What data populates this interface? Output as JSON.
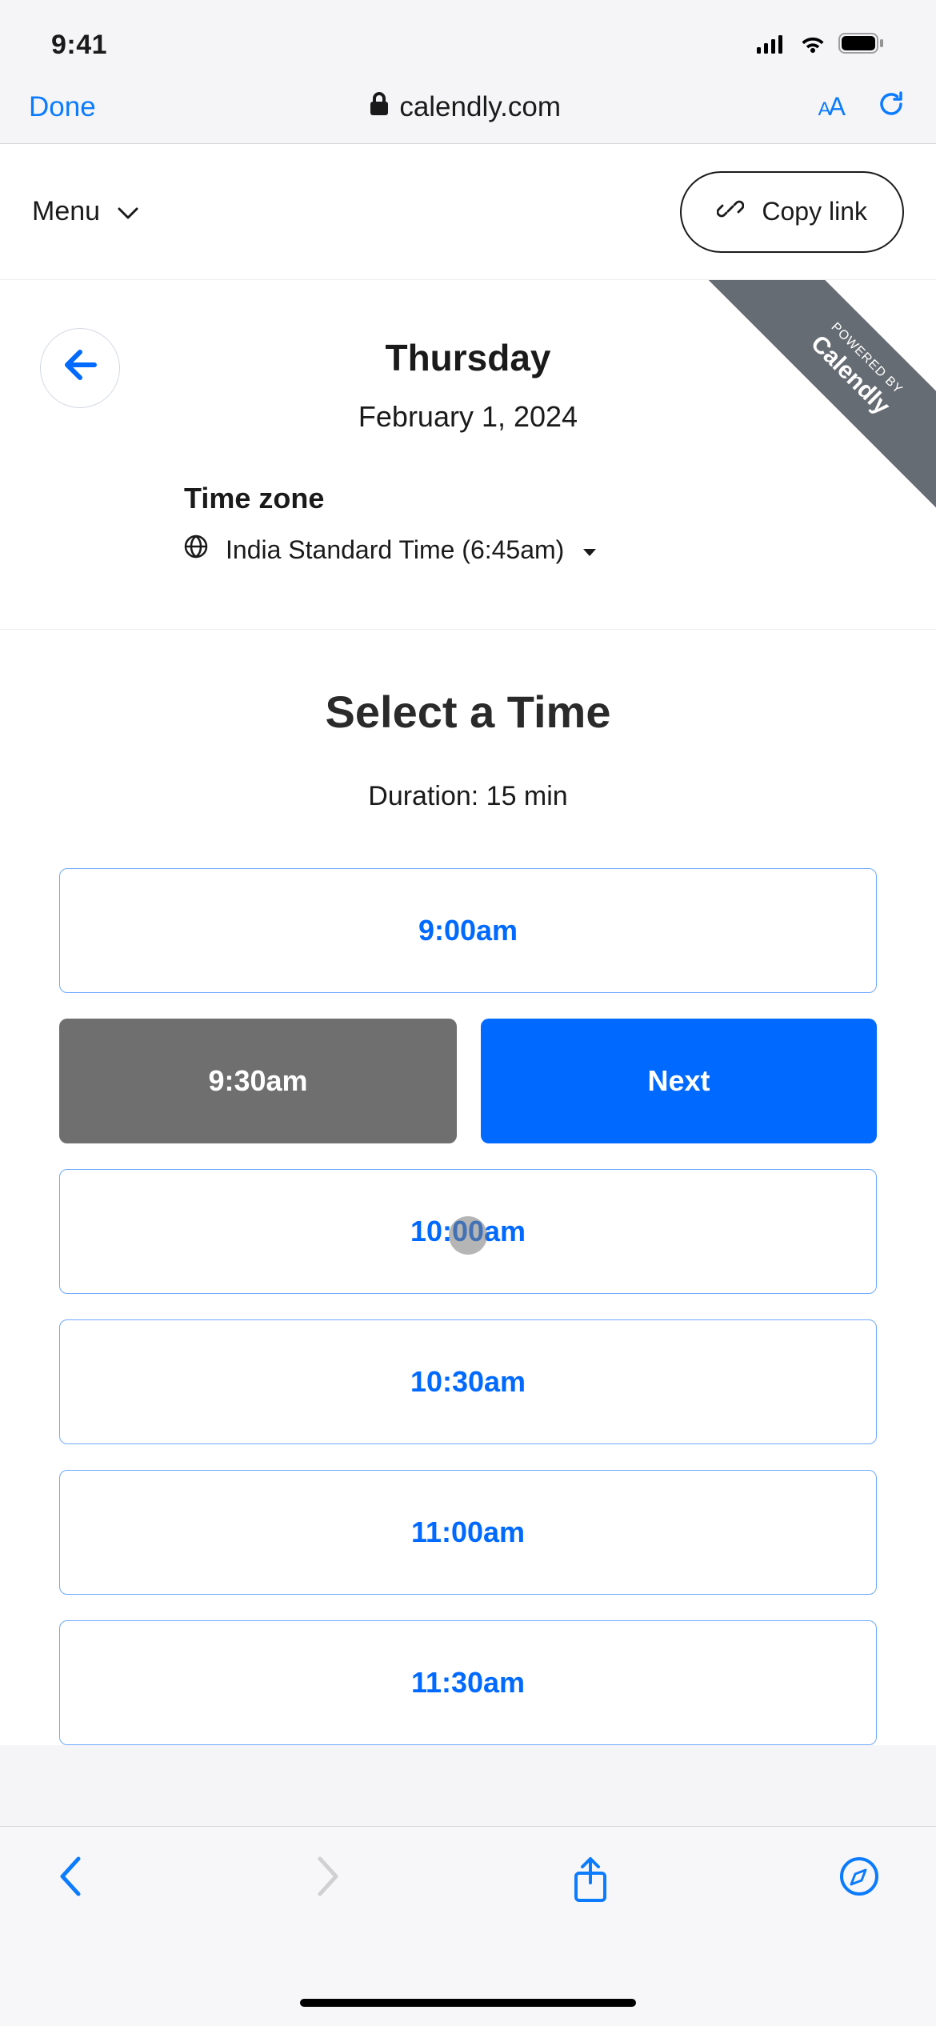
{
  "statusBar": {
    "time": "9:41"
  },
  "urlBar": {
    "doneLabel": "Done",
    "domain": "calendly.com",
    "textSizeLabel": "AA"
  },
  "appHeader": {
    "menuLabel": "Menu",
    "copyLinkLabel": "Copy link"
  },
  "poweredBy": {
    "small": "POWERED BY",
    "big": "Calendly"
  },
  "dateHeader": {
    "dayName": "Thursday",
    "dateStr": "February 1, 2024"
  },
  "timezone": {
    "label": "Time zone",
    "value": "India Standard Time (6:45am)"
  },
  "timeSection": {
    "title": "Select a Time",
    "duration": "Duration: 15 min",
    "nextLabel": "Next",
    "slots": [
      {
        "time": "9:00am",
        "selected": false
      },
      {
        "time": "9:30am",
        "selected": true
      },
      {
        "time": "10:00am",
        "selected": false
      },
      {
        "time": "10:30am",
        "selected": false
      },
      {
        "time": "11:00am",
        "selected": false
      },
      {
        "time": "11:30am",
        "selected": false
      }
    ]
  }
}
